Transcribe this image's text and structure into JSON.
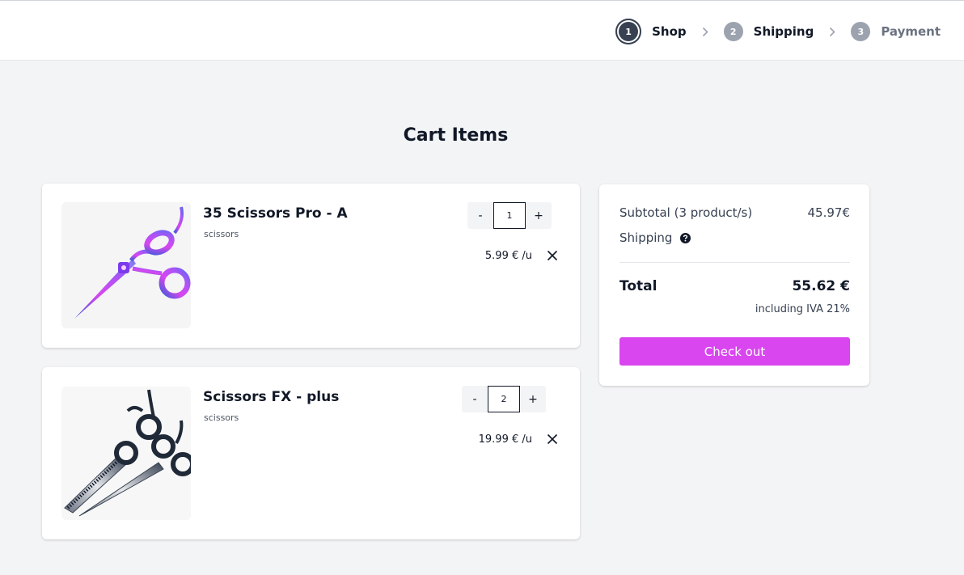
{
  "steps": [
    {
      "number": "1",
      "label": "Shop"
    },
    {
      "number": "2",
      "label": "Shipping"
    },
    {
      "number": "3",
      "label": "Payment"
    }
  ],
  "heading": "Cart Items",
  "items": [
    {
      "name": "35 Scissors Pro - A",
      "category": "scissors",
      "quantity": "1",
      "unit_price": "5.99 € /u",
      "image_icon": "purple-scissors-image"
    },
    {
      "name": "Scissors FX - plus",
      "category": "scissors",
      "quantity": "2",
      "unit_price": "19.99 € /u",
      "image_icon": "silver-scissors-pair-image"
    }
  ],
  "qty_controls": {
    "decrement": "-",
    "increment": "+"
  },
  "summary": {
    "subtotal_label": "Subtotal (3 product/s)",
    "subtotal_value": "45.97€",
    "shipping_label": "Shipping",
    "total_label": "Total",
    "total_value": "55.62 €",
    "tax_note": "including IVA 21%",
    "checkout_label": "Check out"
  },
  "colors": {
    "accent": "#d946ef",
    "active_step": "#374151",
    "inactive_step": "#9ca3af",
    "background": "#f3f4f6"
  }
}
